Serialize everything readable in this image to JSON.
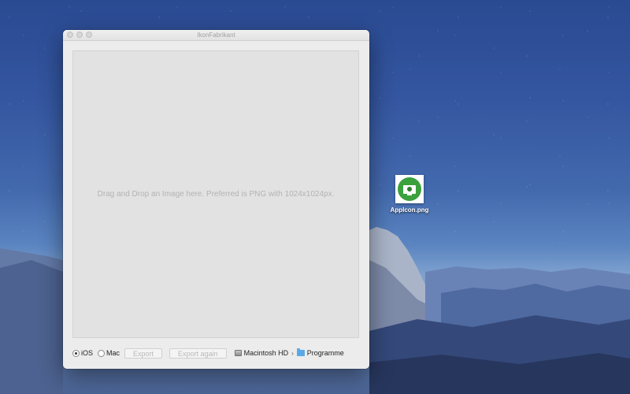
{
  "window": {
    "title": "IkonFabrikant",
    "dropzone_hint": "Drag and Drop an Image here. Preferred is PNG with 1024x1024px."
  },
  "platform": {
    "options": [
      {
        "label": "iOS",
        "selected": true
      },
      {
        "label": "Mac",
        "selected": false
      }
    ]
  },
  "buttons": {
    "export_label": "Export",
    "export_again_label": "Export again"
  },
  "path": {
    "volume": "Macintosh HD",
    "separator": "›",
    "folder": "Programme",
    "volume_icon": "hard-drive-icon",
    "folder_icon": "folder-icon"
  },
  "desktop": {
    "file": {
      "name": "AppIcon.png",
      "icon": "app-icon",
      "icon_color": "#3aa13c"
    }
  }
}
